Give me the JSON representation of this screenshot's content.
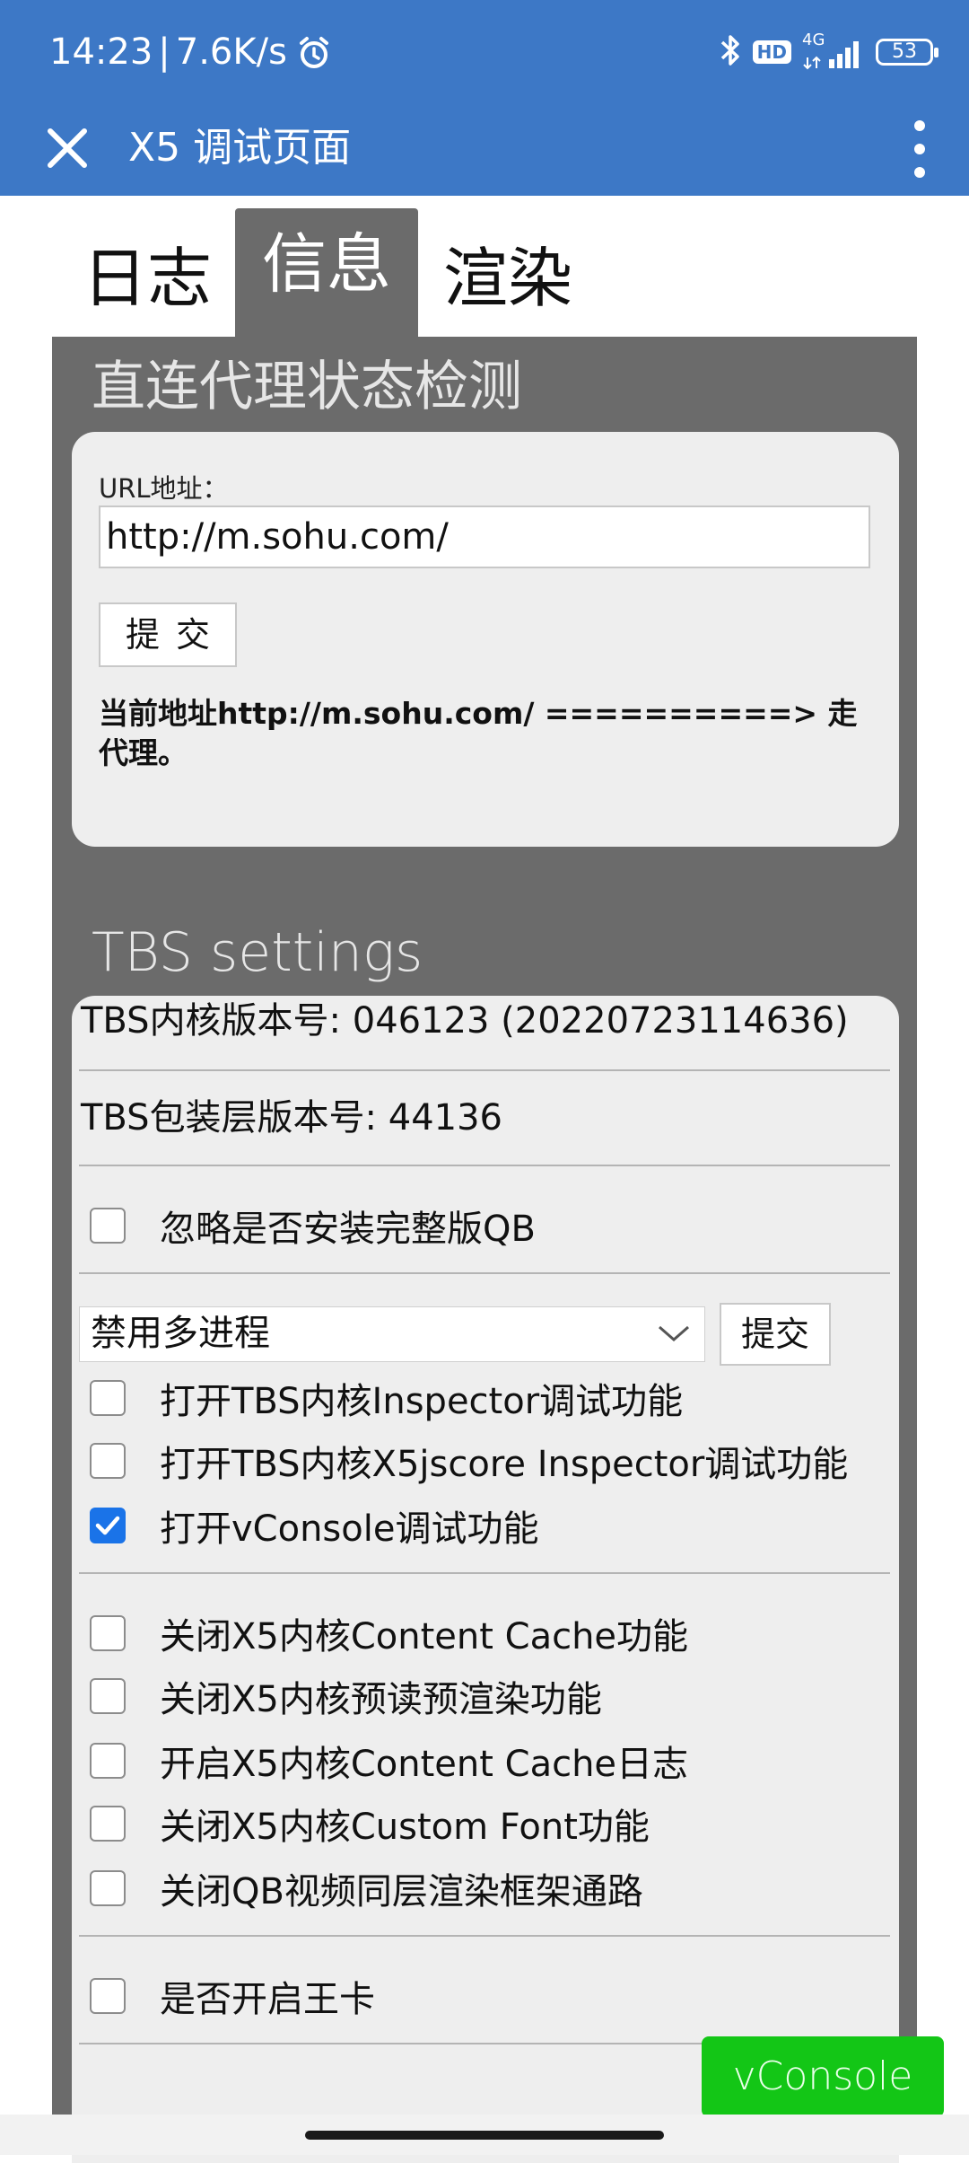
{
  "status_bar": {
    "time": "14:23",
    "divider": "|",
    "speed": "7.6K/s",
    "network_label": "4G",
    "hd_label": "HD",
    "battery": "53"
  },
  "toolbar": {
    "title": "X5 调试页面"
  },
  "tabs": [
    {
      "label": "日志",
      "active": false
    },
    {
      "label": "信息",
      "active": true
    },
    {
      "label": "渲染",
      "active": false
    }
  ],
  "proxy": {
    "section_title": "直连代理状态检测",
    "url_label": "URL地址：",
    "url_value": "http://m.sohu.com/",
    "submit_label": "提交",
    "result_text": "当前地址http://m.sohu.com/ ==========> 走代理。"
  },
  "tbs": {
    "section_title": "TBS settings",
    "kernel_version": "TBS内核版本号: 046123 (20220723114636)",
    "wrapper_version": "TBS包装层版本号: 44136",
    "ignore_qb": {
      "label": "忽略是否安装完整版QB",
      "checked": false
    },
    "multiprocess": {
      "selected": "禁用多进程",
      "submit_label": "提交"
    },
    "debug_options": [
      {
        "label": "打开TBS内核Inspector调试功能",
        "checked": false
      },
      {
        "label": "打开TBS内核X5jscore Inspector调试功能",
        "checked": false
      },
      {
        "label": "打开vConsole调试功能",
        "checked": true
      }
    ],
    "cache_options": [
      {
        "label": "关闭X5内核Content Cache功能",
        "checked": false
      },
      {
        "label": "关闭X5内核预读预渲染功能",
        "checked": false
      },
      {
        "label": "开启X5内核Content Cache日志",
        "checked": false
      },
      {
        "label": "关闭X5内核Custom Font功能",
        "checked": false
      },
      {
        "label": "关闭QB视频同层渲染框架通路",
        "checked": false
      }
    ],
    "king_card": {
      "label": "是否开启王卡",
      "checked": false
    }
  },
  "vconsole_button": "vConsole",
  "colors": {
    "appbar": "#3d78c6",
    "panel": "#6b6b6b",
    "card": "#eeeeee",
    "vconsole": "#13c616",
    "checkbox_checked": "#1a73e8"
  }
}
